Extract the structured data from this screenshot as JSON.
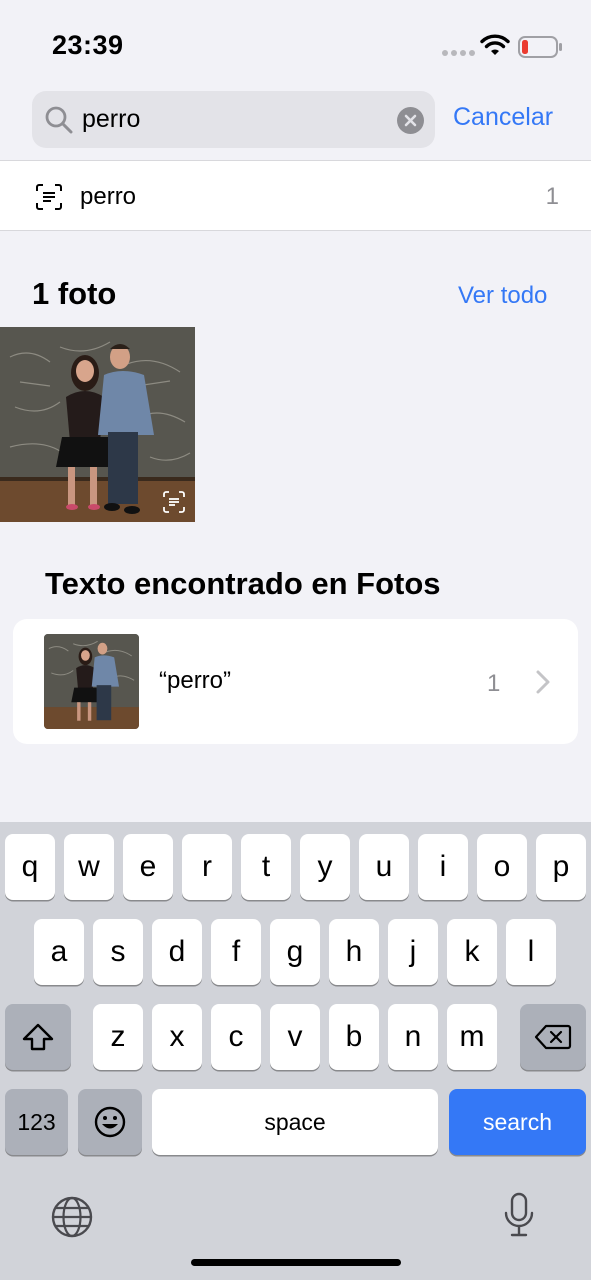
{
  "status_bar": {
    "time": "23:39"
  },
  "search": {
    "query": "perro",
    "cancel_label": "Cancelar"
  },
  "suggestion": {
    "label": "perro",
    "count": "1"
  },
  "photos_section": {
    "title": "1 foto",
    "see_all": "Ver todo"
  },
  "text_section": {
    "title": "Texto encontrado en Fotos"
  },
  "result": {
    "label": "“perro”",
    "count": "1"
  },
  "keyboard": {
    "row1": [
      "q",
      "w",
      "e",
      "r",
      "t",
      "y",
      "u",
      "i",
      "o",
      "p"
    ],
    "row2": [
      "a",
      "s",
      "d",
      "f",
      "g",
      "h",
      "j",
      "k",
      "l"
    ],
    "row3": [
      "z",
      "x",
      "c",
      "v",
      "b",
      "n",
      "m"
    ],
    "numbers_label": "123",
    "space_label": "space",
    "search_label": "search"
  },
  "colors": {
    "accent": "#3478f6",
    "background": "#f2f2f7",
    "keyboard": "#d1d3d9"
  }
}
